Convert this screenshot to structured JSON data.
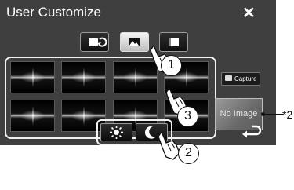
{
  "header": {
    "title": "User Customize",
    "close_label": "✕"
  },
  "tabs": [
    {
      "icon": "screen-cycle-icon",
      "active": false
    },
    {
      "icon": "picture-icon",
      "active": true
    },
    {
      "icon": "monitor-icon",
      "active": false
    }
  ],
  "capture_button": {
    "label": "Capture",
    "icon": "camera-icon"
  },
  "no_image_tile": {
    "label": "No Image"
  },
  "day_night": [
    {
      "icon": "sun-icon"
    },
    {
      "icon": "moon-icon"
    }
  ],
  "back": {
    "icon": "return-arrow-icon"
  },
  "callouts": [
    "1",
    "2",
    "3"
  ],
  "footnote": "*2",
  "colors": {
    "screen_bg": "#3f3f3f",
    "border": "#f2f2f2",
    "active_tab": "#e0e0e0"
  }
}
